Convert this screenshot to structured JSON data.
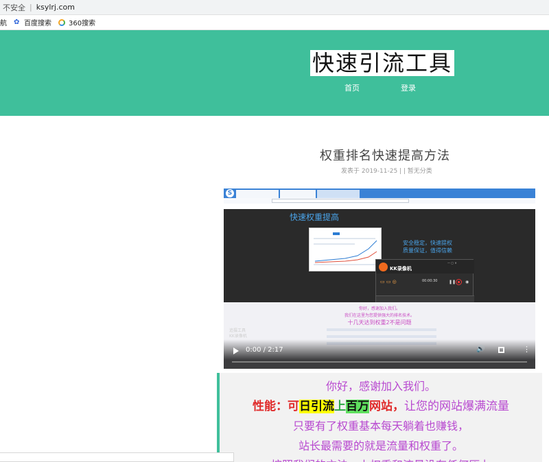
{
  "browser": {
    "security_label": "不安全",
    "url": "ksylrj.com",
    "bookmarks": [
      {
        "label": "航",
        "icon": "bookmark-icon"
      },
      {
        "label": "百度搜索",
        "icon": "baidu-paw-icon"
      },
      {
        "label": "360搜索",
        "icon": "360-search-icon"
      }
    ]
  },
  "site": {
    "title": "快速引流工具",
    "nav": {
      "home": "首页",
      "login": "登录"
    },
    "header_color": "#3fbf9b"
  },
  "post": {
    "title": "权重排名快速提高方法",
    "meta": "发表于 2019-11-25 | | 暂无分类"
  },
  "video": {
    "headline": "快速权重提高",
    "side_text": [
      "安全稳定，快速提权",
      "质量保证，值得信赖"
    ],
    "recorder_name": "KK录像机",
    "recorder_time": "00:00:30",
    "pink_lines": [
      "你好，感谢加入我们。",
      "我们在这里为您提供强大的排名技术。"
    ],
    "pink_big": "十几天达到权重2不是问题",
    "watermark": [
      "追摄工具",
      "KK录像机"
    ],
    "time_label": "0:00 / 2:17"
  },
  "quote": {
    "line1": "你好，感谢加入我们。",
    "line2": {
      "label": "性能：",
      "ke": "可",
      "hl1": "日引流",
      "shang": "上",
      "hl2": "百万",
      "site": "网站",
      "comma": "，",
      "rest": "让您的网站爆满流量"
    },
    "line3": "只要有了权重基本每天躺着也赚钱，",
    "line4": "站长最需要的就是流量和权重了。",
    "line5": "按照我们的方法，上权重和流量没有任何压力"
  }
}
